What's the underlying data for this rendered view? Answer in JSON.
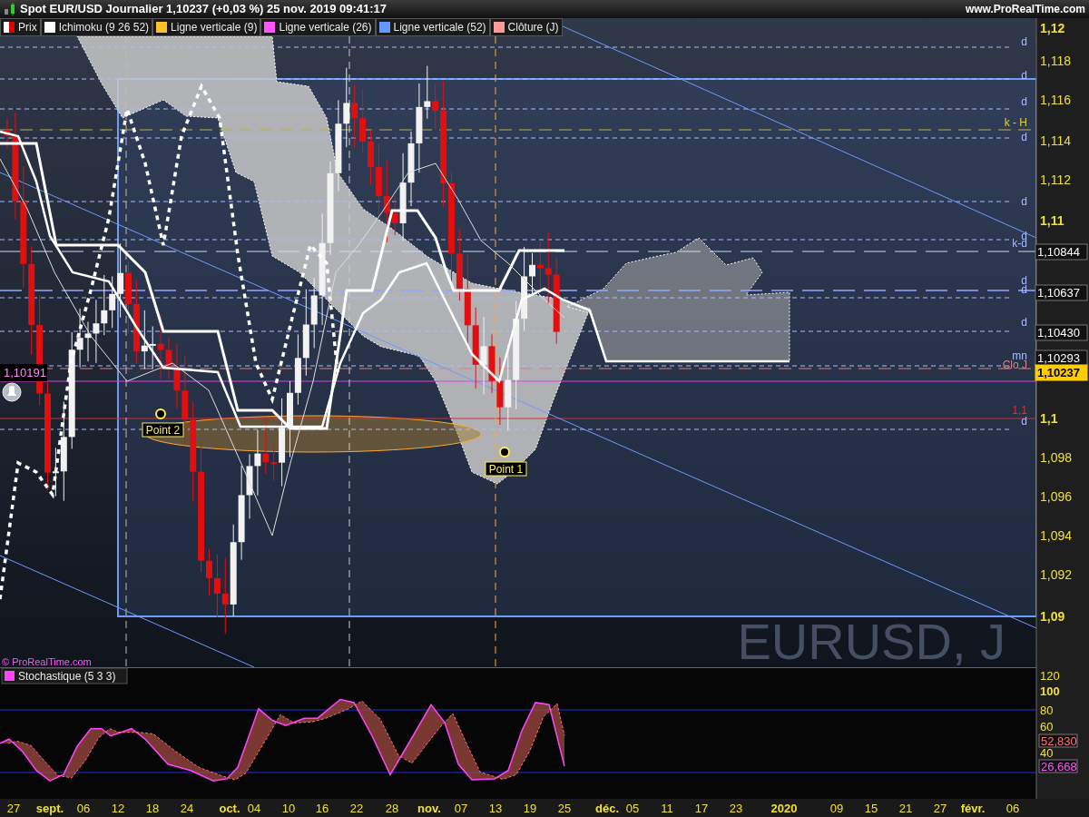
{
  "header": {
    "title": "Spot EUR/USD Journalier 1,10237 (+0,03 %) 25 nov. 2019 09:41:17",
    "site": "www.ProRealTime.com"
  },
  "legend": [
    {
      "label": "Prix",
      "color": "#e00000"
    },
    {
      "label": "Ichimoku (9 26 52)",
      "color": "#ffffff"
    },
    {
      "label": "Ligne verticale (9)",
      "color": "#ffc030"
    },
    {
      "label": "Ligne verticale (26)",
      "color": "#ff55ff"
    },
    {
      "label": "Ligne verticale (52)",
      "color": "#6699ff"
    },
    {
      "label": "Clôture (J)",
      "color": "#ff9a9a"
    }
  ],
  "price_axis": [
    {
      "label": "1,12",
      "major": true
    },
    {
      "label": "1,118",
      "major": false
    },
    {
      "label": "1,116",
      "major": false
    },
    {
      "label": "1,114",
      "major": false
    },
    {
      "label": "1,112",
      "major": false
    },
    {
      "label": "1,11",
      "major": true
    },
    {
      "label": "1,1",
      "major": true
    },
    {
      "label": "1,098",
      "major": false
    },
    {
      "label": "1,096",
      "major": false
    },
    {
      "label": "1,094",
      "major": false
    },
    {
      "label": "1,092",
      "major": false
    },
    {
      "label": "1,09",
      "major": true
    }
  ],
  "price_tags": [
    {
      "label": "1,10844",
      "kind": "level"
    },
    {
      "label": "1,10637",
      "kind": "level"
    },
    {
      "label": "1,10430",
      "kind": "level"
    },
    {
      "label": "1,10293",
      "kind": "level"
    },
    {
      "label": "1,10237",
      "kind": "last"
    }
  ],
  "left_tag": "1,10191",
  "line_labels": [
    {
      "label": "d",
      "color": "#a8bcff"
    },
    {
      "label": "d",
      "color": "#a8bcff"
    },
    {
      "label": "d",
      "color": "#a8bcff"
    },
    {
      "label": "k - H",
      "color": "#d8d040"
    },
    {
      "label": "d",
      "color": "#a8bcff"
    },
    {
      "label": "d",
      "color": "#a8bcff"
    },
    {
      "label": "d",
      "color": "#a8bcff"
    },
    {
      "label": "k-d",
      "color": "#a8bcff"
    },
    {
      "label": "d",
      "color": "#a8bcff"
    },
    {
      "label": "d",
      "color": "#a8bcff"
    },
    {
      "label": "d",
      "color": "#a8bcff"
    },
    {
      "label": "mn",
      "color": "#a8bcff"
    },
    {
      "label": "Clo J",
      "color": "#e08080"
    },
    {
      "label": "1,1",
      "color": "#e03030"
    },
    {
      "label": "d",
      "color": "#a8bcff"
    }
  ],
  "points": [
    "Point 2",
    "Point 1"
  ],
  "watermark": "EURUSD, J",
  "copyright": "© ProRealTime.com",
  "indicator": {
    "title": "Stochastique (5 3 3)",
    "axis": [
      {
        "label": "120",
        "major": false
      },
      {
        "label": "100",
        "major": true
      },
      {
        "label": "80",
        "major": false
      },
      {
        "label": "60",
        "major": false
      },
      {
        "label": "40",
        "major": false
      }
    ],
    "tags": [
      {
        "label": "52,830",
        "color": "#ff7070"
      },
      {
        "label": "26,668",
        "color": "#ff55ff"
      }
    ]
  },
  "date_axis": [
    {
      "label": "27",
      "major": false
    },
    {
      "label": "sept.",
      "major": true
    },
    {
      "label": "06",
      "major": false
    },
    {
      "label": "12",
      "major": false
    },
    {
      "label": "18",
      "major": false
    },
    {
      "label": "24",
      "major": false
    },
    {
      "label": "oct.",
      "major": true
    },
    {
      "label": "04",
      "major": false
    },
    {
      "label": "10",
      "major": false
    },
    {
      "label": "16",
      "major": false
    },
    {
      "label": "22",
      "major": false
    },
    {
      "label": "28",
      "major": false
    },
    {
      "label": "nov.",
      "major": true
    },
    {
      "label": "07",
      "major": false
    },
    {
      "label": "13",
      "major": false
    },
    {
      "label": "19",
      "major": false
    },
    {
      "label": "25",
      "major": false
    },
    {
      "label": "déc.",
      "major": true
    },
    {
      "label": "05",
      "major": false
    },
    {
      "label": "11",
      "major": false
    },
    {
      "label": "17",
      "major": false
    },
    {
      "label": "23",
      "major": false
    },
    {
      "label": "2020",
      "major": true
    },
    {
      "label": "09",
      "major": false
    },
    {
      "label": "15",
      "major": false
    },
    {
      "label": "21",
      "major": false
    },
    {
      "label": "27",
      "major": false
    },
    {
      "label": "févr.",
      "major": true
    },
    {
      "label": "06",
      "major": false
    }
  ]
}
